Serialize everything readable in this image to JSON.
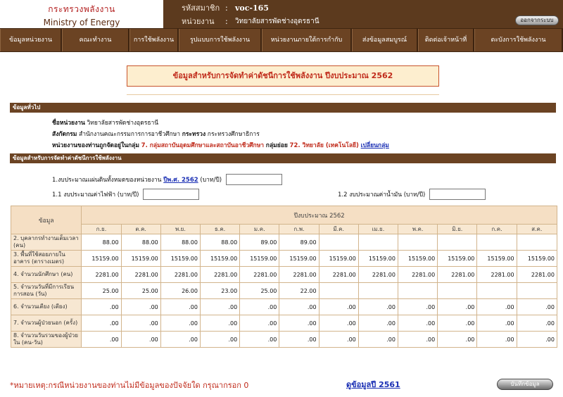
{
  "header": {
    "logo_th": "กระทรวงพลังงาน",
    "logo_en": "Ministry of Energy",
    "member_label": "รหัสสมาชิก",
    "member_value": "voc-165",
    "org_label": "หน่วยงาน",
    "org_value": "วิทยาลัยสารพัดช่างอุดรธานี",
    "logout_label": "ออกจากระบบ"
  },
  "nav": {
    "items": [
      "ข้อมูลหน่วยงาน",
      "คณะทำงาน",
      "การใช้พลังงาน",
      "รูปแบบการใช้พลังงาน",
      "หน่วยงานภายใต้การกำกับ",
      "ส่งข้อมูลสมบูรณ์",
      "ติดต่อเจ้าหน้าที่",
      "ตะบังการใช้พลังงาน"
    ]
  },
  "title": "ข้อมูลสำหรับการจัดทำค่าดัชนีการใช้พลังงาน ปีงบประมาณ 2562",
  "section_general": {
    "label": "ข้อมูลทั่วไป",
    "org_name_label": "ชื่อหน่วยงาน",
    "org_name_value": "วิทยาลัยสารพัดช่างอุดรธานี",
    "affiliation_label": "สังกัดกรม",
    "affiliation_value": "สำนักงานคณะกรรมการการอาชีวศึกษา",
    "ministry_label": "กระทรวง",
    "ministry_value": "กระทรวงศึกษาธิการ",
    "group_prefix": "หน่วยงานของท่านถูกจัดอยู่ในกลุ่ม",
    "group_value": "7. กลุ่มสถาบันอุดมศึกษาและสถาบันอาชีวศึกษา",
    "subgroup_label": "กลุ่มย่อย",
    "subgroup_value": "72. วิทยาลัย (เทคโนโลยี)",
    "change_group_link": "เปลี่ยนกลุ่ม"
  },
  "section_index": {
    "label": "ข้อมูลสำหรับการจัดทำค่าดัชนีการใช้พลังงาน",
    "budget_total_label": "1.งบประมาณแผ่นดินทั้งหมดของหน่วยงาน",
    "budget_year_link": "ปีพ.ศ. 2562",
    "budget_unit": "(บาท/ปี)",
    "budget_total_value": "",
    "budget_electric_label": "1.1 งบประมาณค่าไฟฟ้า (บาท/ปี)",
    "budget_electric_value": "",
    "budget_fuel_label": "1.2 งบประมาณค่าน้ำมัน (บาท/ปี)",
    "budget_fuel_value": ""
  },
  "table": {
    "col_header": "ข้อมูล",
    "year_header": "ปีงบประมาณ 2562",
    "months": [
      "ต.ค.",
      "พ.ย.",
      "ธ.ค.",
      "ม.ค.",
      "ก.พ.",
      "มี.ค.",
      "เม.ย.",
      "พ.ค.",
      "มิ.ย.",
      "ก.ค.",
      "ส.ค."
    ],
    "month_first": "ก.ย.",
    "rows": [
      {
        "label": "2. บุคลากรทำงานเต็มเวลา (คน)",
        "values": [
          "88.00",
          "88.00",
          "88.00",
          "88.00",
          "89.00",
          "89.00",
          "",
          "",
          "",
          "",
          "",
          ""
        ]
      },
      {
        "label": "3. พื้นที่ใช้สอยภายในอาคาร (ตารางเมตร)",
        "values": [
          "15159.00",
          "15159.00",
          "15159.00",
          "15159.00",
          "15159.00",
          "15159.00",
          "15159.00",
          "15159.00",
          "15159.00",
          "15159.00",
          "15159.00",
          "15159.00"
        ]
      },
      {
        "label": "4. จำนวนนักศึกษา (คน)",
        "values": [
          "2281.00",
          "2281.00",
          "2281.00",
          "2281.00",
          "2281.00",
          "2281.00",
          "2281.00",
          "2281.00",
          "2281.00",
          "2281.00",
          "2281.00",
          "2281.00"
        ]
      },
      {
        "label": "5. จำนวนวันที่มีการเรียนการสอน (วัน)",
        "values": [
          "25.00",
          "25.00",
          "26.00",
          "23.00",
          "25.00",
          "22.00",
          "",
          "",
          "",
          "",
          "",
          ""
        ]
      },
      {
        "label": "6. จำนวนเตียง (เตียง)",
        "values": [
          ".00",
          ".00",
          ".00",
          ".00",
          ".00",
          ".00",
          ".00",
          ".00",
          ".00",
          ".00",
          ".00",
          ".00"
        ]
      },
      {
        "label": "7. จำนวนผู้ป่วยนอก (ครั้ง)",
        "values": [
          ".00",
          ".00",
          ".00",
          ".00",
          ".00",
          ".00",
          ".00",
          ".00",
          ".00",
          ".00",
          ".00",
          ".00"
        ]
      },
      {
        "label": "8. จำนวนวันรวมของผู้ป่วยใน (คน-วัน)",
        "values": [
          ".00",
          ".00",
          ".00",
          ".00",
          ".00",
          ".00",
          ".00",
          ".00",
          ".00",
          ".00",
          ".00",
          ".00"
        ]
      }
    ]
  },
  "footer": {
    "note": "*หมายเหตุ:กรณีหน่วยงานของท่านไม่มีข้อมูลของปัจจัยใด กรุณากรอก 0",
    "prev_year_link": "ดูข้อมูลปี 2561",
    "save_label": "บันทึกข้อมูล"
  }
}
